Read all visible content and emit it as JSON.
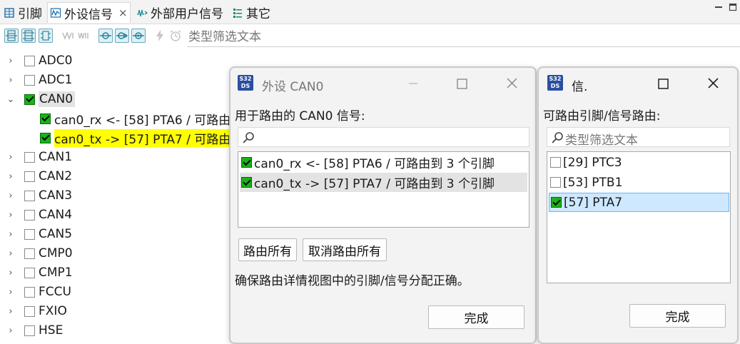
{
  "tabs": [
    {
      "label": "引脚",
      "icon": "grid-icon"
    },
    {
      "label": "外设信号",
      "icon": "waveform-icon",
      "close": "×"
    },
    {
      "label": "外部用户信号",
      "icon": "signal-icon"
    },
    {
      "label": "其它",
      "icon": "list-icon"
    }
  ],
  "toolbar": {
    "filter_placeholder": "类型筛选文本"
  },
  "tree": [
    {
      "label": "ADC0",
      "checked": false
    },
    {
      "label": "ADC1",
      "checked": false
    },
    {
      "label": "CAN0",
      "checked": true,
      "expanded": true
    },
    {
      "label": "can0_rx <- [58] PTA6 / 可路由",
      "checked": true,
      "child": true
    },
    {
      "label": "can0_tx -> [57] PTA7 / 可路由",
      "checked": true,
      "child": true,
      "highlight": true
    },
    {
      "label": "CAN1",
      "checked": false
    },
    {
      "label": "CAN2",
      "checked": false
    },
    {
      "label": "CAN3",
      "checked": false
    },
    {
      "label": "CAN4",
      "checked": false
    },
    {
      "label": "CAN5",
      "checked": false
    },
    {
      "label": "CMP0",
      "checked": false
    },
    {
      "label": "CMP1",
      "checked": false
    },
    {
      "label": "FCCU",
      "checked": false
    },
    {
      "label": "FXIO",
      "checked": false
    },
    {
      "label": "HSE",
      "checked": false
    }
  ],
  "dialog1": {
    "title": "外设 CAN0",
    "heading": "用于路由的 CAN0 信号:",
    "items": [
      {
        "label": "can0_rx <- [58] PTA6 / 可路由到 3 个引脚",
        "checked": true
      },
      {
        "label": "can0_tx -> [57] PTA7 / 可路由到 3 个引脚",
        "checked": true,
        "selected": true
      }
    ],
    "route_all": "路由所有",
    "unroute_all": "取消路由所有",
    "note": "确保路由详情视图中的引脚/信号分配正确。",
    "done": "完成"
  },
  "dialog2": {
    "title": "信.",
    "heading": "可路由引脚/信号路由:",
    "search_placeholder": "类型筛选文本",
    "items": [
      {
        "label": "[29] PTC3",
        "checked": false
      },
      {
        "label": "[53] PTB1",
        "checked": false
      },
      {
        "label": "[57] PTA7",
        "checked": true,
        "selected": true
      }
    ],
    "done": "完成"
  },
  "app_icon_text": "S32DS",
  "colors": {
    "accent": "#2a4fa0",
    "check": "#17b417",
    "highlight": "#ffff00",
    "selection_blue": "#cde8ff"
  }
}
